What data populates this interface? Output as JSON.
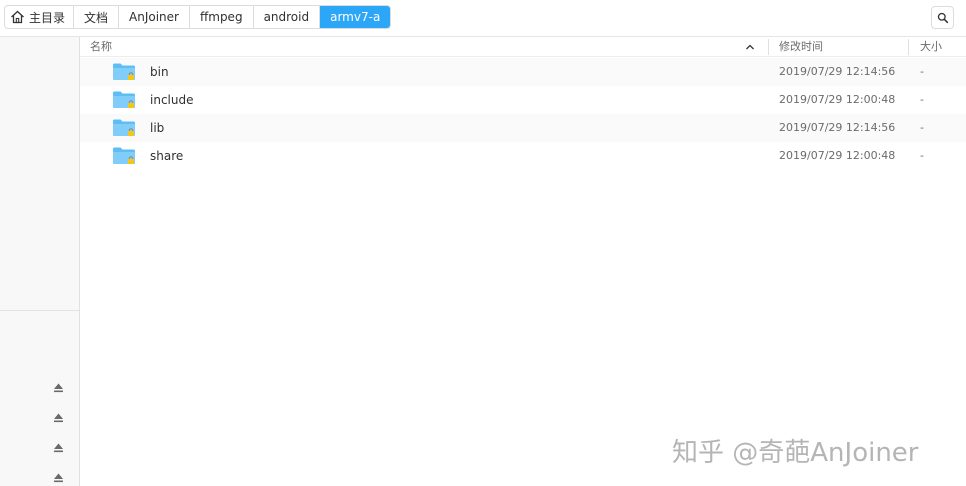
{
  "breadcrumbs": {
    "home": "主目录",
    "items": [
      "文档",
      "AnJoiner",
      "ffmpeg",
      "android",
      "armv7-a"
    ]
  },
  "icons": {
    "home": "home-icon",
    "search": "search-icon",
    "folder": "folder-lock-icon",
    "eject": "eject-icon",
    "sort": "chevron-up-icon"
  },
  "colors": {
    "accent": "#2ca7f8",
    "folder": "#5fbdf5",
    "lock": "#f5c518"
  },
  "columns": {
    "name": "名称",
    "modified": "修改时间",
    "size": "大小"
  },
  "files": [
    {
      "name": "bin",
      "modified": "2019/07/29 12:14:56",
      "size": "-"
    },
    {
      "name": "include",
      "modified": "2019/07/29 12:00:48",
      "size": "-"
    },
    {
      "name": "lib",
      "modified": "2019/07/29 12:14:56",
      "size": "-"
    },
    {
      "name": "share",
      "modified": "2019/07/29 12:00:48",
      "size": "-"
    }
  ],
  "watermark": "知乎 @奇葩AnJoiner"
}
